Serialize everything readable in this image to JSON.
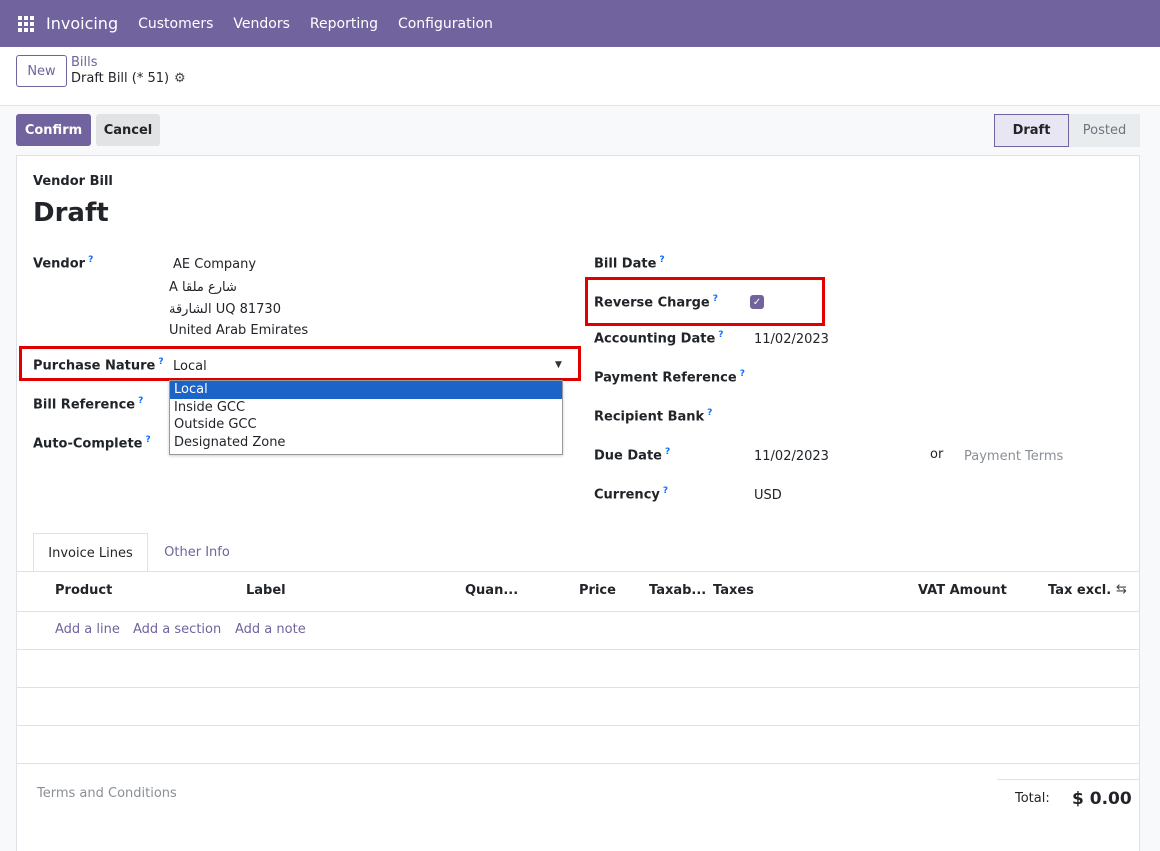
{
  "topbar": {
    "app_name": "Invoicing",
    "menu": [
      "Customers",
      "Vendors",
      "Reporting",
      "Configuration"
    ]
  },
  "control": {
    "new_label": "New",
    "breadcrumb_parent": "Bills",
    "breadcrumb_current": "Draft Bill (* 51)",
    "gear_glyph": "⚙"
  },
  "actions": {
    "confirm_label": "Confirm",
    "cancel_label": "Cancel"
  },
  "status": {
    "draft": "Draft",
    "posted": "Posted"
  },
  "form": {
    "type_label": "Vendor Bill",
    "title": "Draft",
    "q": "?",
    "vendor_label": "Vendor",
    "vendor_name": "AE Company",
    "vendor_addr1": "A شارع ملقا",
    "vendor_addr2": "الشارقة UQ 81730",
    "vendor_addr3": "United Arab Emirates",
    "purchase_nature_label": "Purchase Nature",
    "purchase_nature_value": "Local",
    "purchase_nature_options": [
      "Local",
      "Inside GCC",
      "Outside GCC",
      "Designated Zone"
    ],
    "bill_reference_label": "Bill Reference",
    "auto_complete_label": "Auto-Complete",
    "bill_date_label": "Bill Date",
    "reverse_charge_label": "Reverse Charge",
    "reverse_charge_checked": true,
    "accounting_date_label": "Accounting Date",
    "accounting_date_value": "11/02/2023",
    "payment_reference_label": "Payment Reference",
    "recipient_bank_label": "Recipient Bank",
    "due_date_label": "Due Date",
    "due_date_value": "11/02/2023",
    "or_text": "or",
    "payment_terms_placeholder": "Payment Terms",
    "currency_label": "Currency",
    "currency_value": "USD"
  },
  "tabs": [
    "Invoice Lines",
    "Other Info"
  ],
  "lines": {
    "columns": [
      "Product",
      "Label",
      "Quan...",
      "Price",
      "Taxab...",
      "Taxes",
      "VAT Amount",
      "Tax excl."
    ],
    "add_line": "Add a line",
    "add_section": "Add a section",
    "add_note": "Add a note"
  },
  "footer": {
    "terms_placeholder": "Terms and Conditions",
    "total_label": "Total:",
    "total_value": "$ 0.00"
  }
}
